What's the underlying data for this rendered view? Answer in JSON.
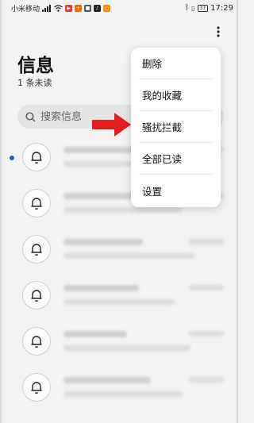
{
  "status_bar": {
    "carrier": "小米移动",
    "battery": "37",
    "time": "17:29"
  },
  "header": {
    "title": "信息",
    "unread": "1 条未读"
  },
  "search": {
    "placeholder": "搜索信息"
  },
  "popup_menu": {
    "items": [
      {
        "label": "删除"
      },
      {
        "label": "我的收藏"
      },
      {
        "label": "骚扰拦截"
      },
      {
        "label": "全部已读"
      },
      {
        "label": "设置"
      }
    ]
  },
  "messages": {
    "count": 6
  },
  "colors": {
    "unread_dot": "#1565c0",
    "arrow": "#e02020"
  }
}
